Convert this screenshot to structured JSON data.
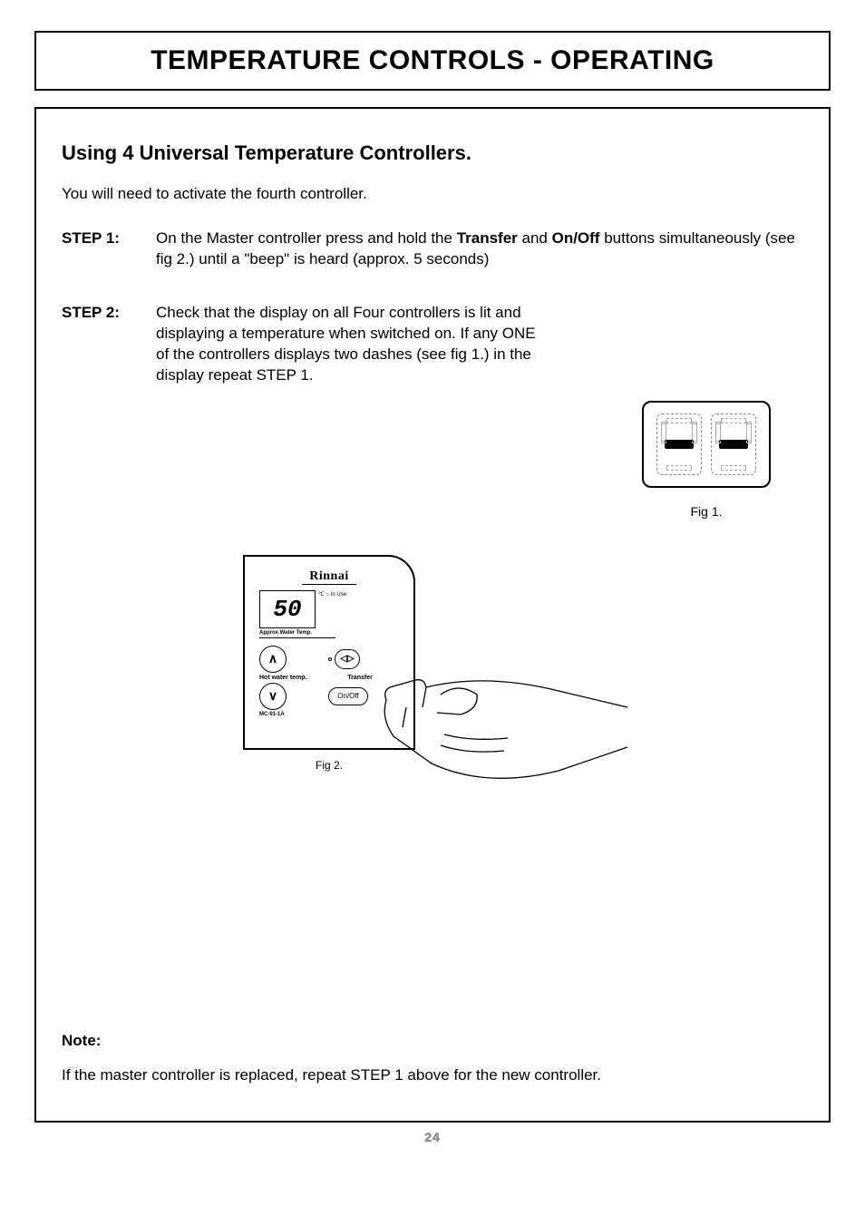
{
  "title": "TEMPERATURE CONTROLS - OPERATING",
  "section_heading": "Using 4 Universal Temperature Controllers.",
  "intro": "You will need to activate the fourth controller.",
  "steps": [
    {
      "label": "STEP  1:",
      "text_prefix": "On the Master controller press and hold the ",
      "bold1": "Transfer",
      "mid": " and ",
      "bold2": "On/Off",
      "text_suffix": " buttons simultaneously (see fig 2.) until a \"beep\" is heard (approx. 5 seconds)"
    },
    {
      "label": "STEP  2:",
      "text": "Check that the display on all Four controllers is lit and displaying a temperature when switched on. If any ONE of the controllers displays two dashes (see fig 1.) in the display repeat STEP 1."
    }
  ],
  "fig1_caption": "Fig 1.",
  "fig2_caption": "Fig 2.",
  "controller": {
    "brand": "Rinnai",
    "temp": "50",
    "unit": "℃",
    "in_use": "In Use",
    "approx": "Approx Water Temp.",
    "hot_label": "Hot water temp.",
    "transfer": "Transfer",
    "onoff": "On/Off",
    "model": "MC-91-1A"
  },
  "note": {
    "heading": "Note:",
    "body": "If the master controller is replaced, repeat STEP 1 above for the new controller."
  },
  "page_number": "24"
}
